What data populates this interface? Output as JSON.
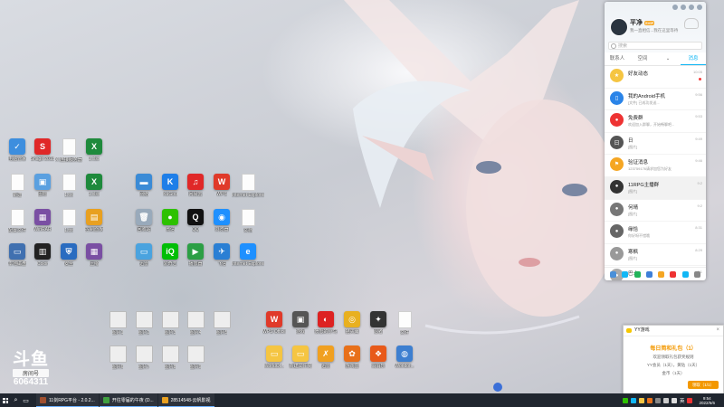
{
  "desktop": {
    "icons": [
      {
        "id": "i01",
        "label": "电脑管家",
        "color": "#3d8ede",
        "glyph": "✓",
        "kind": "app"
      },
      {
        "id": "i02",
        "label": "Snagit 2018",
        "color": "#e02828",
        "glyph": "S",
        "kind": "app"
      },
      {
        "id": "i03",
        "label": "X 连接服务器",
        "color": "#fff",
        "glyph": "",
        "kind": "file"
      },
      {
        "id": "i04",
        "label": "1.xlsx",
        "color": "#1e8a3c",
        "glyph": "X",
        "kind": "app"
      },
      {
        "id": "i05",
        "label": "新建",
        "color": "#fff",
        "glyph": "",
        "kind": "file"
      },
      {
        "id": "i06",
        "label": "图标",
        "color": "#5aa0e0",
        "glyph": "▣",
        "kind": "app"
      },
      {
        "id": "i07",
        "label": "1.txt",
        "color": "#fff",
        "glyph": "",
        "kind": "file"
      },
      {
        "id": "i08",
        "label": "1.xlsx",
        "color": "#1e8a3c",
        "glyph": "X",
        "kind": "app"
      },
      {
        "id": "i09",
        "label": "配置文件",
        "color": "#fff",
        "glyph": "",
        "kind": "file"
      },
      {
        "id": "i10",
        "label": "WinRAR",
        "color": "#7a4fa3",
        "glyph": "▦",
        "kind": "app"
      },
      {
        "id": "i11",
        "label": "1.txt",
        "color": "#fff",
        "glyph": "",
        "kind": "file"
      },
      {
        "id": "i12",
        "label": "控制面板",
        "color": "#e8a020",
        "glyph": "▤",
        "kind": "app"
      },
      {
        "id": "i13",
        "label": "本地磁盘",
        "color": "#4070b0",
        "glyph": "▭",
        "kind": "app"
      },
      {
        "id": "i14",
        "label": "Color",
        "color": "#222",
        "glyph": "▥",
        "kind": "app"
      },
      {
        "id": "i15",
        "label": "安全",
        "color": "#2a6cc0",
        "glyph": "⛨",
        "kind": "app"
      },
      {
        "id": "i16",
        "label": "压缩",
        "color": "#7a4fa3",
        "glyph": "▦",
        "kind": "app"
      },
      {
        "id": "i17",
        "label": "网络",
        "color": "#3b8bd6",
        "glyph": "▬",
        "kind": "app"
      },
      {
        "id": "i18",
        "label": "KuGou",
        "color": "#1e7ee8",
        "glyph": "K",
        "kind": "app"
      },
      {
        "id": "i19",
        "label": "网易云",
        "color": "#e02828",
        "glyph": "♫",
        "kind": "app"
      },
      {
        "id": "i20",
        "label": "WPS",
        "color": "#e03a2a",
        "glyph": "W",
        "kind": "app"
      },
      {
        "id": "i21",
        "label": "Internet Explorer",
        "color": "#fff",
        "glyph": "",
        "kind": "file"
      },
      {
        "id": "i22",
        "label": "回收站",
        "color": "#9ab",
        "glyph": "🗑",
        "kind": "app"
      },
      {
        "id": "i23",
        "label": "微信",
        "color": "#2dc100",
        "glyph": "●",
        "kind": "app"
      },
      {
        "id": "i24",
        "label": "QQ",
        "color": "#111",
        "glyph": "Q",
        "kind": "app"
      },
      {
        "id": "i25",
        "label": "浏览器",
        "color": "#1e90ff",
        "glyph": "◉",
        "kind": "app"
      },
      {
        "id": "i26",
        "label": "文档",
        "color": "#fff",
        "glyph": "",
        "kind": "file"
      },
      {
        "id": "i27",
        "label": "迅雷",
        "color": "#4aa3df",
        "glyph": "▭",
        "kind": "app"
      },
      {
        "id": "i28",
        "label": "爱奇艺",
        "color": "#00be06",
        "glyph": "iQ",
        "kind": "app"
      },
      {
        "id": "i29",
        "label": "播放器",
        "color": "#2c9f45",
        "glyph": "▶",
        "kind": "app"
      },
      {
        "id": "i30",
        "label": "飞信",
        "color": "#2a7fd4",
        "glyph": "✈",
        "kind": "app"
      },
      {
        "id": "i31",
        "label": "Internet Explorer",
        "color": "#1e90ff",
        "glyph": "e",
        "kind": "app"
      },
      {
        "id": "r01",
        "label": "图片1",
        "color": "#ddd",
        "glyph": "",
        "kind": "thumb"
      },
      {
        "id": "r02",
        "label": "图片2",
        "color": "#ddd",
        "glyph": "",
        "kind": "thumb"
      },
      {
        "id": "r03",
        "label": "图片3",
        "color": "#ddd",
        "glyph": "",
        "kind": "thumb"
      },
      {
        "id": "r04",
        "label": "图片4",
        "color": "#ddd",
        "glyph": "",
        "kind": "thumb"
      },
      {
        "id": "r05",
        "label": "图片5",
        "color": "#fff",
        "glyph": "",
        "kind": "thumb"
      },
      {
        "id": "r06",
        "label": "图片6",
        "color": "#ddd",
        "glyph": "",
        "kind": "thumb"
      },
      {
        "id": "r07",
        "label": "图片7",
        "color": "#ddd",
        "glyph": "",
        "kind": "thumb"
      },
      {
        "id": "r08",
        "label": "图片8",
        "color": "#ddd",
        "glyph": "",
        "kind": "thumb"
      },
      {
        "id": "r09",
        "label": "图片9",
        "color": "#ddd",
        "glyph": "",
        "kind": "thumb"
      },
      {
        "id": "g01",
        "label": "WPS Office",
        "color": "#e03a2a",
        "glyph": "W",
        "kind": "app"
      },
      {
        "id": "g02",
        "label": "游戏",
        "color": "#555",
        "glyph": "▣",
        "kind": "app"
      },
      {
        "id": "g03",
        "label": "愤怒的小鸟",
        "color": "#d22",
        "glyph": "◐",
        "kind": "app"
      },
      {
        "id": "g04",
        "label": "猫头鹰",
        "color": "#e8b020",
        "glyph": "◎",
        "kind": "app"
      },
      {
        "id": "g05",
        "label": "忍者",
        "color": "#333",
        "glyph": "✦",
        "kind": "app"
      },
      {
        "id": "g06",
        "label": "文件",
        "color": "#fff",
        "glyph": "",
        "kind": "file"
      },
      {
        "id": "g07",
        "label": "WorldOf...",
        "color": "#f5c542",
        "glyph": "▭",
        "kind": "app"
      },
      {
        "id": "g08",
        "label": "新建文件夹",
        "color": "#f5c542",
        "glyph": "▭",
        "kind": "app"
      },
      {
        "id": "g09",
        "label": "迅雷",
        "color": "#f0a020",
        "glyph": "✗",
        "kind": "app"
      },
      {
        "id": "g10",
        "label": "游戏盒",
        "color": "#e8701a",
        "glyph": "✿",
        "kind": "app"
      },
      {
        "id": "g11",
        "label": "消消乐",
        "color": "#e85a1a",
        "glyph": "❖",
        "kind": "app"
      },
      {
        "id": "g12",
        "label": "Worldof...",
        "color": "#3d7fd0",
        "glyph": "◍",
        "kind": "app"
      }
    ]
  },
  "douyu": {
    "mark": "斗鱼",
    "room_label": "房间号",
    "room_number": "6064311"
  },
  "qq": {
    "nickname": "平净",
    "badge": "SVIP",
    "signature": "我一直相信...我在这里等待",
    "search_placeholder": "搜索",
    "tabs": [
      {
        "label": "联系人"
      },
      {
        "label": "空间"
      },
      {
        "label": "⌄"
      },
      {
        "label": "消息"
      }
    ],
    "active_tab": 3,
    "conversations": [
      {
        "title": "好友动态",
        "preview": "",
        "time": "10:05",
        "color": "#f5c542",
        "glyph": "★",
        "unread": true
      },
      {
        "title": "我的Android手机",
        "preview": "[文件] 已成功发送...",
        "time": "9:56",
        "color": "#2a84e8",
        "glyph": "▯",
        "unread": false
      },
      {
        "title": "免费群",
        "preview": "欢迎加入群聊，开始畅聊吧...",
        "time": "9:53",
        "color": "#e33",
        "glyph": "●",
        "unread": false
      },
      {
        "title": "日",
        "preview": "[图片]",
        "time": "9:49",
        "color": "#555",
        "glyph": "日",
        "unread": false
      },
      {
        "title": "验证消息",
        "preview": "123759176请求加您为好友",
        "time": "9:46",
        "color": "#f5a623",
        "glyph": "⚑",
        "unread": false
      },
      {
        "title": "11RPG主播群",
        "preview": "[图片]",
        "time": "9:2",
        "color": "#333",
        "glyph": "●",
        "unread": false
      },
      {
        "title": "何晴",
        "preview": "[图片]",
        "time": "9:2",
        "color": "#777",
        "glyph": "●",
        "unread": false
      },
      {
        "title": "缘恰",
        "preview": "你好呀不错哦",
        "time": "8:31",
        "color": "#666",
        "glyph": "●",
        "unread": false
      },
      {
        "title": "寒枫",
        "preview": "[图片]",
        "time": "8:29",
        "color": "#999",
        "glyph": "●",
        "unread": false
      },
      {
        "title": "巴士",
        "preview": "",
        "time": "8:1",
        "color": "#aaa",
        "glyph": "●",
        "unread": false
      }
    ],
    "bottom_icons": [
      {
        "name": "menu-icon",
        "color": "#4a90d9"
      },
      {
        "name": "qq-penguin-icon",
        "color": "#12b7f5"
      },
      {
        "name": "music-icon",
        "color": "#21b35a"
      },
      {
        "name": "game-icon",
        "color": "#3e7fd8"
      },
      {
        "name": "folder-icon",
        "color": "#f5a623"
      },
      {
        "name": "mail-icon",
        "color": "#e33"
      },
      {
        "name": "cloud-icon",
        "color": "#12b7f5"
      },
      {
        "name": "grid-icon",
        "color": "#888"
      }
    ]
  },
  "yy": {
    "title": "YY游戏",
    "close": "×",
    "headline": "每日简和礼包（1）",
    "line1": "欢迎领取礼包获奖规则",
    "line2": "YY会员（1天），黄钻（1天）",
    "line3": "金币（1天）",
    "button": "领取（1/1）"
  },
  "taskbar": {
    "tasks": [
      {
        "label": "11剑RPG平台 - 2.0.2...",
        "color": "#a05030"
      },
      {
        "label": "开往零届的午夜 (D...",
        "color": "#40a040"
      },
      {
        "label": "28514548-云帆影视",
        "color": "#e8a020"
      }
    ],
    "ime": "英",
    "time": "9:54",
    "date": "2022/6/6"
  }
}
